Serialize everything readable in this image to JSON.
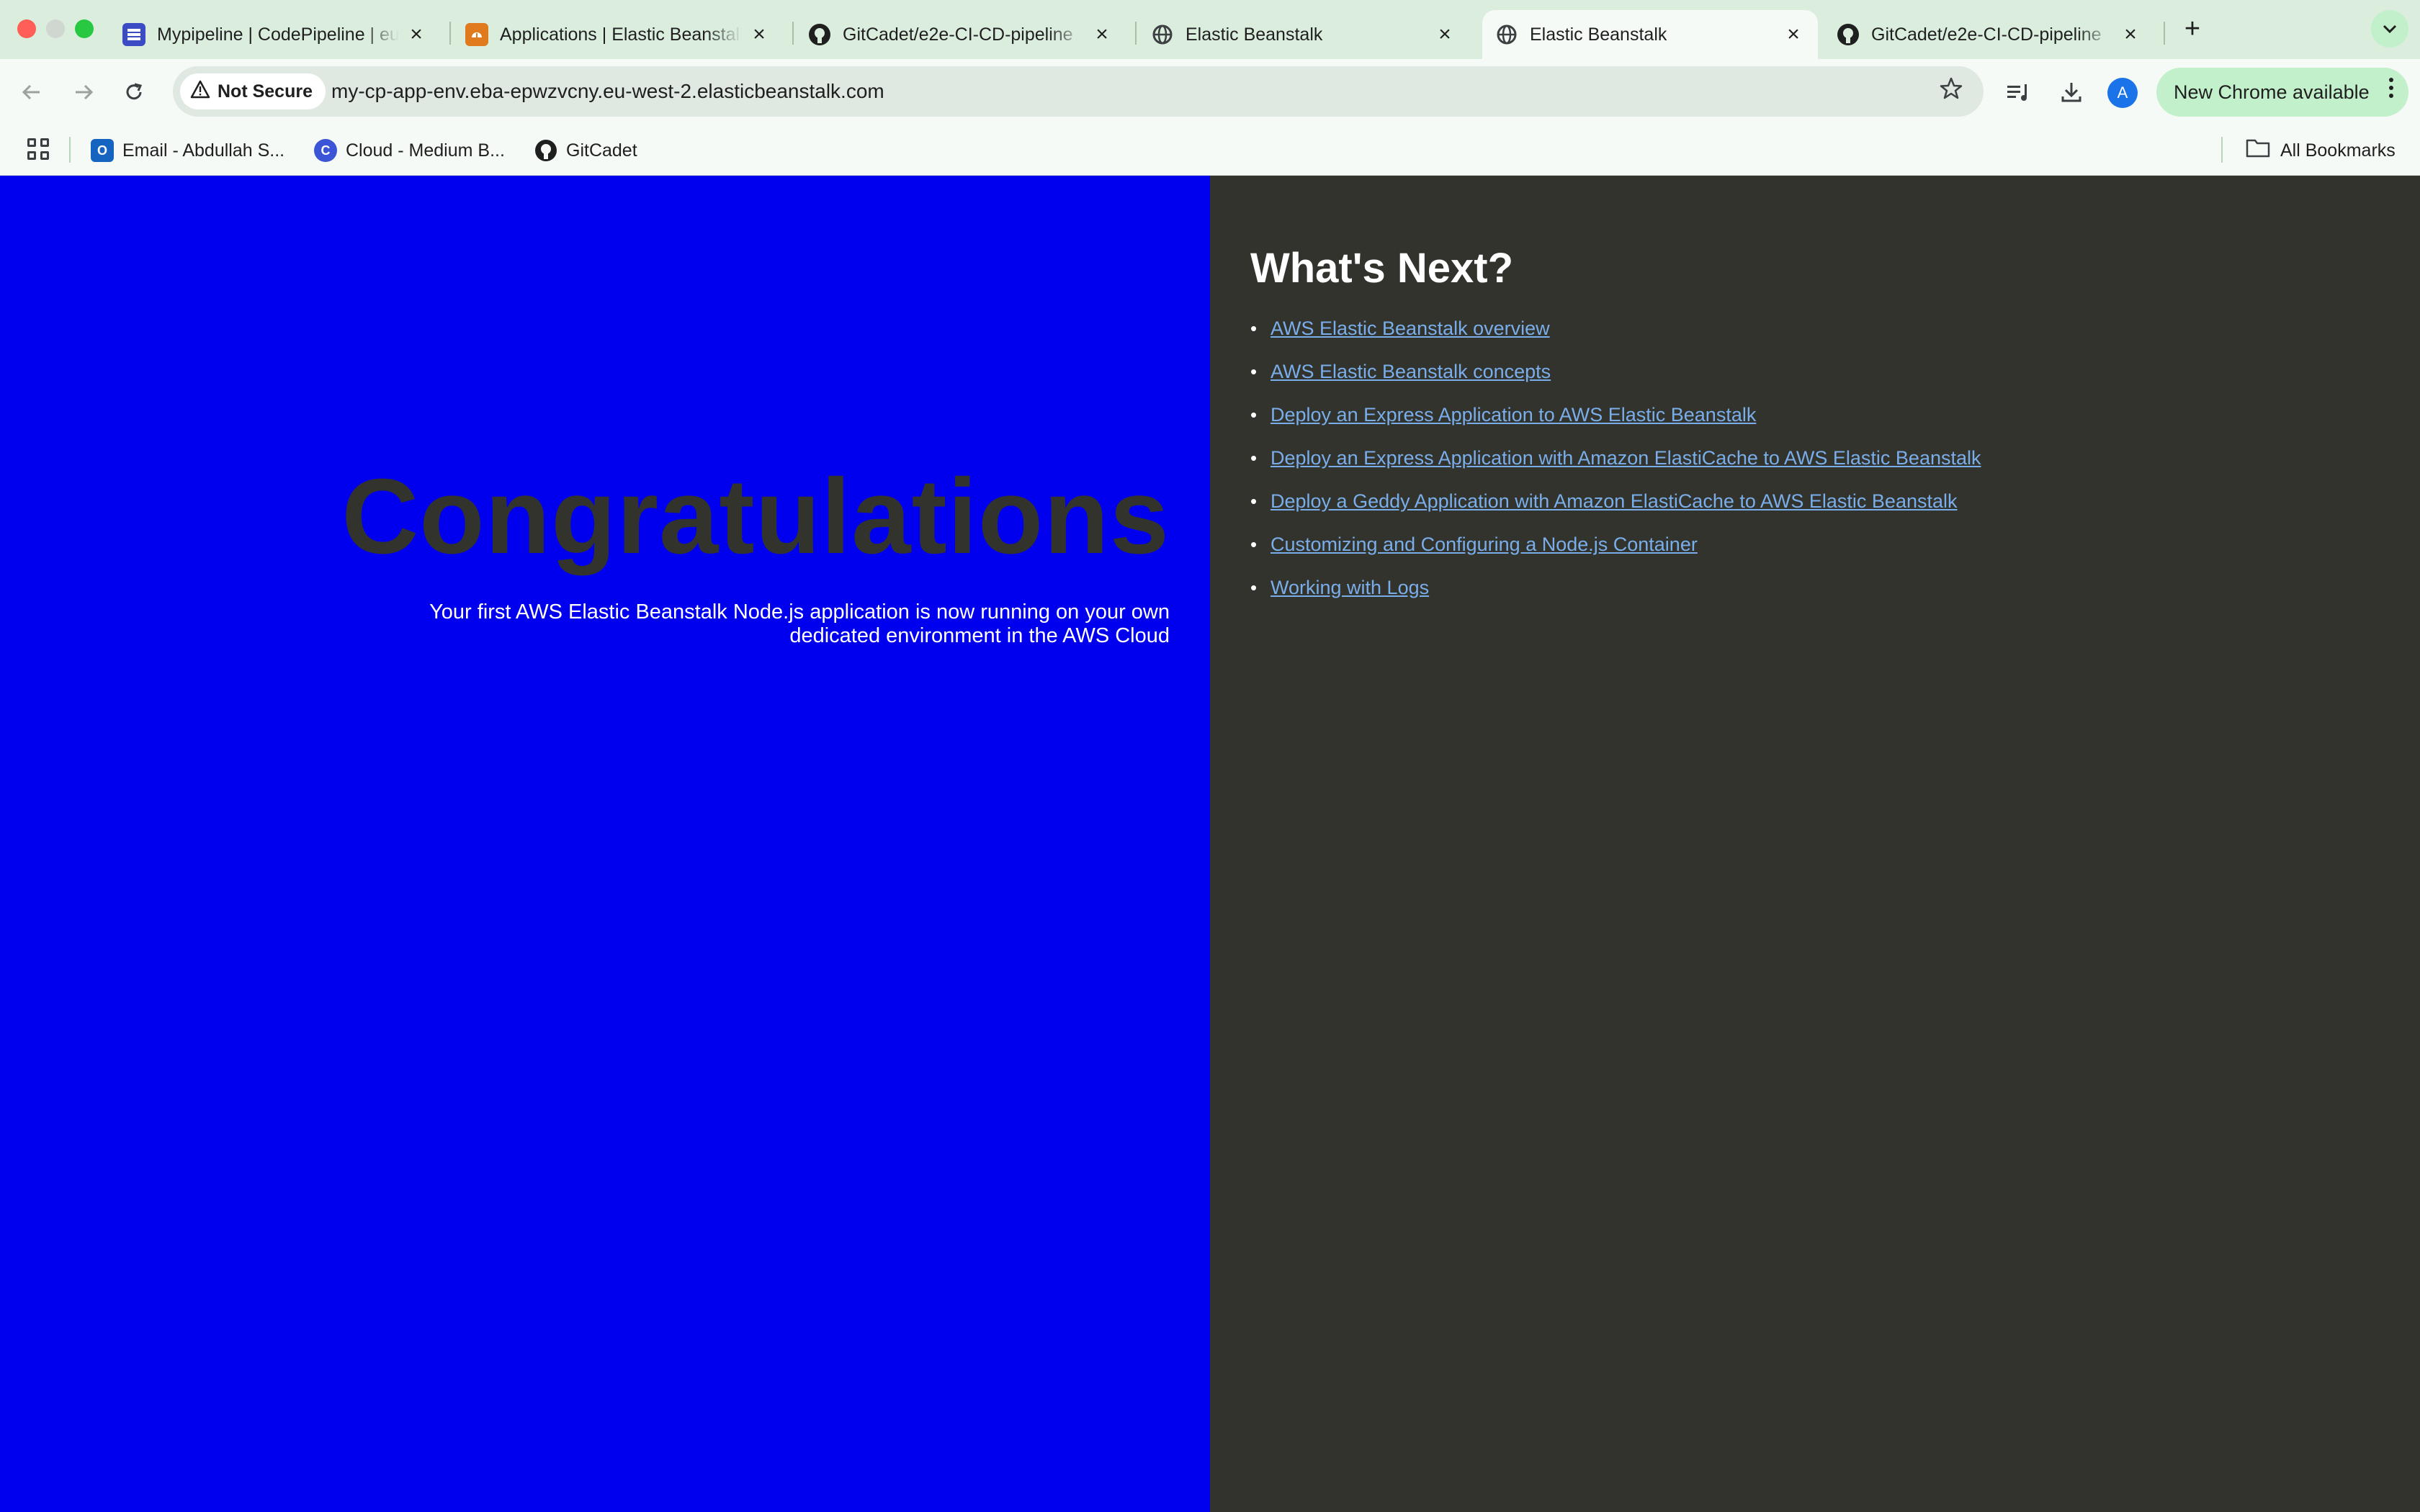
{
  "browser": {
    "tabs": [
      {
        "title": "Mypipeline | CodePipeline | eu-west-2",
        "icon": "codepipeline-icon",
        "active": false
      },
      {
        "title": "Applications | Elastic Beanstalk",
        "icon": "elastic-beanstalk-icon",
        "active": false
      },
      {
        "title": "GitCadet/e2e-CI-CD-pipeline",
        "icon": "github-icon",
        "active": false
      },
      {
        "title": "Elastic Beanstalk",
        "icon": "globe-icon",
        "active": false
      },
      {
        "title": "Elastic Beanstalk",
        "icon": "globe-icon",
        "active": true
      },
      {
        "title": "GitCadet/e2e-CI-CD-pipeline",
        "icon": "github-icon",
        "active": false
      }
    ],
    "tab_close_glyph": "×",
    "new_tab_glyph": "+",
    "address_bar": {
      "security_label": "Not Secure",
      "url": "my-cp-app-env.eba-epwzvcny.eu-west-2.elasticbeanstalk.com"
    },
    "profile_initial": "A",
    "update_button_label": "New Chrome available",
    "bookmarks": [
      {
        "label": "Email - Abdullah S...",
        "icon": "outlook-icon"
      },
      {
        "label": "Cloud - Medium B...",
        "icon": "medium-icon"
      },
      {
        "label": "GitCadet",
        "icon": "github-icon"
      }
    ],
    "all_bookmarks_label": "All Bookmarks",
    "colors": {
      "tabstrip_bg": "#dbeede",
      "toolbar_bg": "#f5faf6",
      "update_chip": "#c2f0cb"
    }
  },
  "page": {
    "left": {
      "heading": "Congratulations",
      "subtext": "Your first AWS Elastic Beanstalk Node.js application is now running on your own dedicated environment in the AWS Cloud",
      "background": "#0000ee"
    },
    "right": {
      "heading": "What's Next?",
      "links": [
        "AWS Elastic Beanstalk overview",
        "AWS Elastic Beanstalk concepts",
        "Deploy an Express Application to AWS Elastic Beanstalk",
        "Deploy an Express Application with Amazon ElastiCache to AWS Elastic Beanstalk",
        "Deploy a Geddy Application with Amazon ElastiCache to AWS Elastic Beanstalk",
        "Customizing and Configuring a Node.js Container",
        "Working with Logs"
      ],
      "background": "#33332d",
      "link_color": "#7aaeea"
    }
  }
}
